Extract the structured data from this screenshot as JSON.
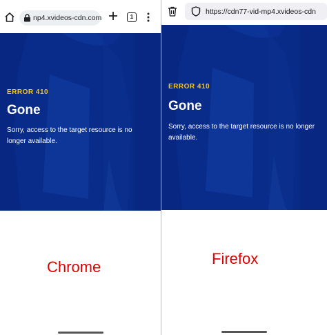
{
  "chrome": {
    "url": "np4.xvideos-cdn.com",
    "tab_count": "1",
    "icons": [
      "home-icon",
      "lock-icon",
      "plus-icon",
      "tabs-icon",
      "overflow-menu-icon"
    ]
  },
  "firefox": {
    "url": "https://cdn77-vid-mp4.xvideos-cdn",
    "icons": [
      "trash-icon",
      "shield-icon"
    ]
  },
  "page": {
    "error_code": "ERROR 410",
    "title": "Gone",
    "message": "Sorry, access to the target resource is no longer available.",
    "accent_color": "#f5c518",
    "hero_color": "#0b2d8c"
  },
  "labels": {
    "left": "Chrome",
    "right": "Firefox",
    "color": "#e00000"
  }
}
